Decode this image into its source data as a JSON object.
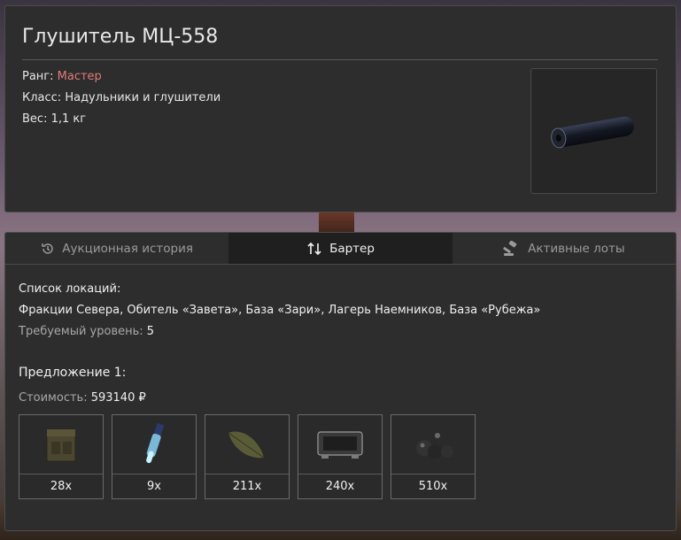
{
  "item": {
    "title": "Глушитель МЦ-558",
    "rank_label": "Ранг:",
    "rank_value": "Мастер",
    "class_label": "Класс:",
    "class_value": "Надульники и глушители",
    "weight_label": "Вес:",
    "weight_value": "1,1 кг",
    "colors": {
      "rank": "#e07a7a",
      "panel": "#2d2d2d"
    }
  },
  "tabs": [
    {
      "label": "Аукционная история",
      "icon": "history-icon",
      "active": false
    },
    {
      "label": "Бартер",
      "icon": "swap-arrows-icon",
      "active": true
    },
    {
      "label": "Активные лоты",
      "icon": "gavel-icon",
      "active": false
    }
  ],
  "barter": {
    "locations_label": "Список локаций:",
    "locations_value": "Фракции Севера, Обитель «Завета», База «Зари», Лагерь Наемников, База «Рубежа»",
    "level_label": "Требуемый уровень:",
    "level_value": "5",
    "offer_title": "Предложение 1:",
    "cost_label": "Стоимость:",
    "cost_value": "593140 ₽",
    "items": [
      {
        "icon": "ammo-box-icon",
        "qty": "28x"
      },
      {
        "icon": "glowing-vial-icon",
        "qty": "9x"
      },
      {
        "icon": "leaf-icon",
        "qty": "211x"
      },
      {
        "icon": "device-case-icon",
        "qty": "240x"
      },
      {
        "icon": "dark-spheres-icon",
        "qty": "510x"
      }
    ]
  }
}
